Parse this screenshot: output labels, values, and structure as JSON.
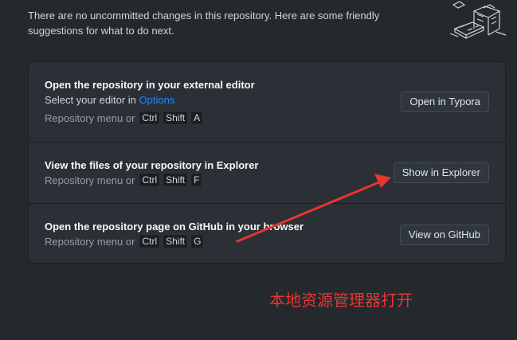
{
  "intro": {
    "text": "There are no uncommitted changes in this repository. Here are some friendly suggestions for what to do next."
  },
  "suggestions": [
    {
      "title": "Open the repository in your external editor",
      "desc_prefix": "Select your editor in ",
      "desc_link": "Options",
      "shortcut_prefix": "Repository menu or",
      "keys": [
        "Ctrl",
        "Shift",
        "A"
      ],
      "button": "Open in Typora"
    },
    {
      "title": "View the files of your repository in Explorer",
      "shortcut_prefix": "Repository menu or",
      "keys": [
        "Ctrl",
        "Shift",
        "F"
      ],
      "button": "Show in Explorer"
    },
    {
      "title": "Open the repository page on GitHub in your browser",
      "shortcut_prefix": "Repository menu or",
      "keys": [
        "Ctrl",
        "Shift",
        "G"
      ],
      "button": "View on GitHub"
    }
  ],
  "annotation": {
    "text": "本地资源管理器打开",
    "color": "#e8352f"
  },
  "colors": {
    "background": "#24292e",
    "panel": "#2b3036",
    "link": "#2188ff"
  }
}
